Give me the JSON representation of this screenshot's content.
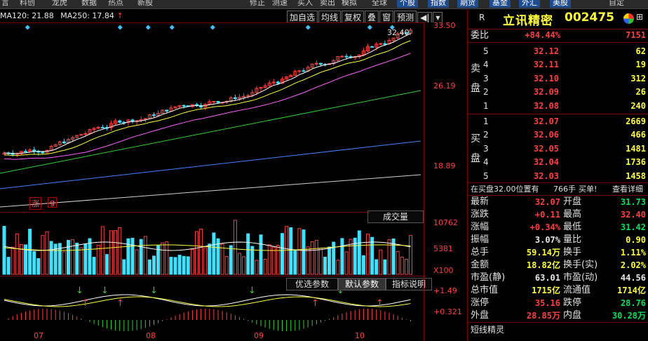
{
  "toolbar": {
    "items": [
      "言",
      "科创",
      "龙虎",
      "数据",
      "热点",
      "新股",
      "",
      "",
      "",
      "",
      "",
      "",
      "",
      "",
      "",
      "修正",
      "测速",
      "买入",
      "卖出",
      "模拟",
      "全球",
      "个股",
      "指数",
      "期货",
      "基金",
      "外汇",
      "美股",
      "自定"
    ]
  },
  "chart_header": {
    "ma120": "MA120: 21.88",
    "ma250": "MA250: 17.84"
  },
  "chart_tools": [
    "加自选",
    "均线",
    "复权",
    "叠",
    "窗",
    "预测",
    "◀|",
    "▾"
  ],
  "price_axis": [
    "33.50",
    "26.19",
    "18.89"
  ],
  "price_annotation": "32.40",
  "markers": [
    "涨",
    "g"
  ],
  "volume": {
    "title": "成交量",
    "axis": [
      "10762",
      "5381",
      "X100"
    ]
  },
  "indicator": {
    "tabs": [
      "优选参数",
      "默认参数",
      "指标说明"
    ],
    "axis": [
      "+1.49",
      "+0.321"
    ]
  },
  "months": [
    "07",
    "08",
    "09",
    "10"
  ],
  "stock": {
    "badge": "R",
    "name": "立讯精密",
    "code": "002475"
  },
  "order_ratio": {
    "label": "委比",
    "pct": "+84.44%",
    "diff": "7151"
  },
  "sell_label": [
    "卖",
    "盘"
  ],
  "buy_label": [
    "买",
    "盘"
  ],
  "asks": [
    {
      "level": "5",
      "price": "32.12",
      "vol": "62"
    },
    {
      "level": "4",
      "price": "32.11",
      "vol": "19"
    },
    {
      "level": "3",
      "price": "32.10",
      "vol": "312"
    },
    {
      "level": "2",
      "price": "32.09",
      "vol": "26"
    },
    {
      "level": "1",
      "price": "32.08",
      "vol": "240"
    }
  ],
  "bids": [
    {
      "level": "1",
      "price": "32.07",
      "vol": "2669"
    },
    {
      "level": "2",
      "price": "32.06",
      "vol": "466"
    },
    {
      "level": "3",
      "price": "32.05",
      "vol": "1481"
    },
    {
      "level": "4",
      "price": "32.04",
      "vol": "1736"
    },
    {
      "level": "5",
      "price": "32.03",
      "vol": "1458"
    }
  ],
  "notice": {
    "text": "在买盘32.00位置有",
    "vol": "766手",
    "tail": "买单!",
    "link": "查看详细"
  },
  "stats": [
    {
      "l1": "最新",
      "v1": "32.07",
      "c1": "red",
      "l2": "开盘",
      "v2": "31.73",
      "c2": "grn"
    },
    {
      "l1": "涨跌",
      "v1": "+0.11",
      "c1": "red",
      "l2": "最高",
      "v2": "32.40",
      "c2": "red"
    },
    {
      "l1": "涨幅",
      "v1": "+0.34%",
      "c1": "red",
      "l2": "最低",
      "v2": "31.42",
      "c2": "grn"
    },
    {
      "l1": "振幅",
      "v1": "3.07%",
      "c1": "wh",
      "l2": "量比",
      "v2": "0.90",
      "c2": "yl"
    },
    {
      "l1": "总手",
      "v1": "59.14万",
      "c1": "yl",
      "l2": "换手",
      "v2": "1.11%",
      "c2": "yl"
    },
    {
      "l1": "金额",
      "v1": "18.82亿",
      "c1": "yl",
      "l2": "换手(实)",
      "v2": "2.02%",
      "c2": "yl"
    },
    {
      "l1": "市盈(静)",
      "v1": "63.01",
      "c1": "wh",
      "l2": "市盈(动)",
      "v2": "44.56",
      "c2": "wh"
    },
    {
      "l1": "总市值",
      "v1": "1715亿",
      "c1": "yl",
      "l2": "流通值",
      "v2": "1714亿",
      "c2": "yl"
    },
    {
      "l1": "涨停",
      "v1": "35.16",
      "c1": "red",
      "l2": "跌停",
      "v2": "28.76",
      "c2": "grn"
    },
    {
      "l1": "外盘",
      "v1": "28.85万",
      "c1": "red",
      "l2": "内盘",
      "v2": "30.28万",
      "c2": "grn"
    }
  ],
  "short_title": "短线精灵"
}
